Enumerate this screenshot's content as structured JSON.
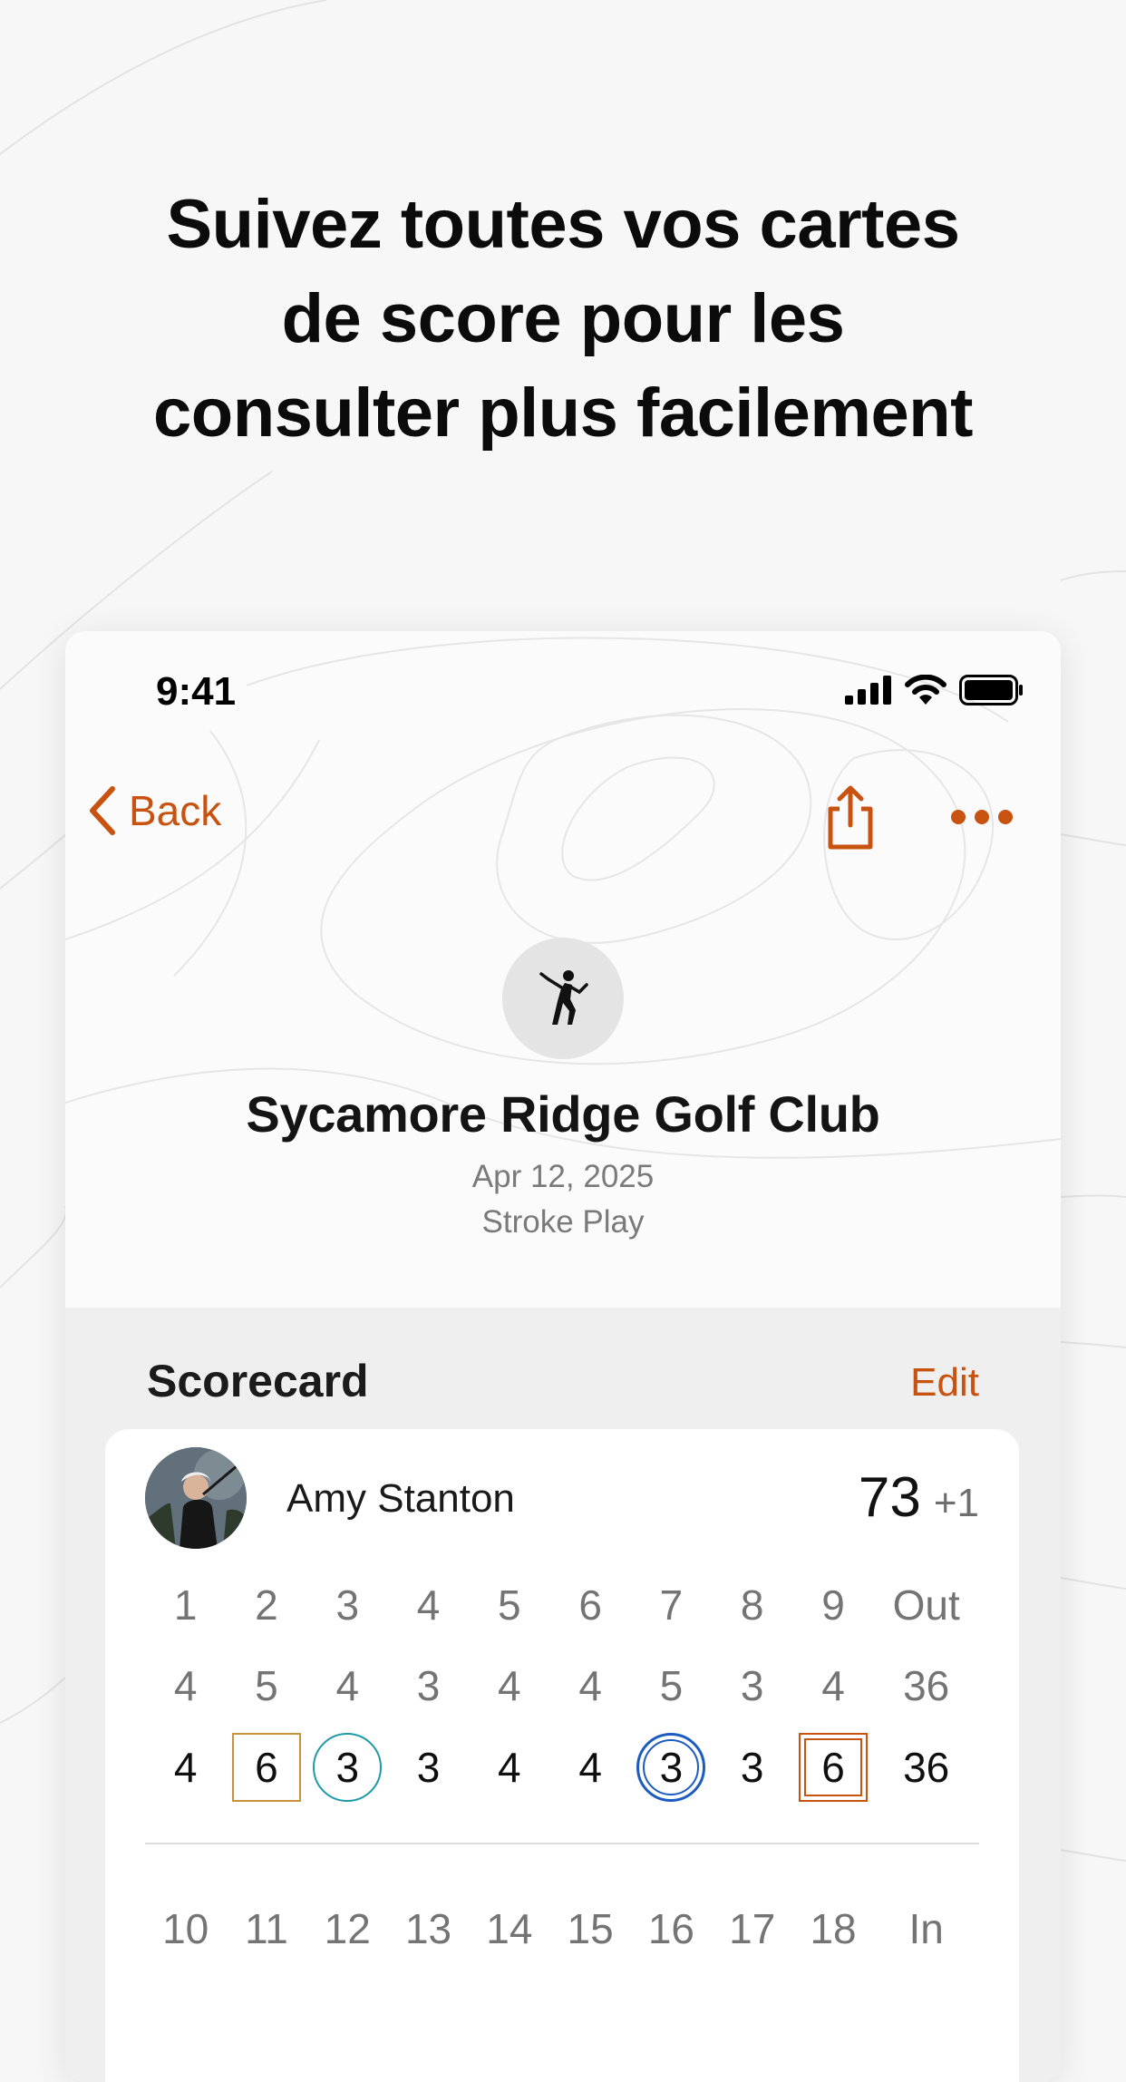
{
  "headline": {
    "line1": "Suivez toutes vos cartes",
    "line2": "de score pour les",
    "line3": "consulter plus facilement"
  },
  "status_bar": {
    "time": "9:41"
  },
  "nav": {
    "back_label": "Back"
  },
  "course": {
    "name": "Sycamore Ridge Golf Club",
    "date": "Apr 12, 2025",
    "mode": "Stroke Play"
  },
  "scorecard": {
    "title": "Scorecard",
    "edit_label": "Edit",
    "player": {
      "name": "Amy Stanton",
      "total": "73",
      "relative": "+1"
    },
    "front": {
      "holes": [
        "1",
        "2",
        "3",
        "4",
        "5",
        "6",
        "7",
        "8",
        "9",
        "Out"
      ],
      "par": [
        "4",
        "5",
        "4",
        "3",
        "4",
        "4",
        "5",
        "3",
        "4",
        "36"
      ],
      "scores": [
        "4",
        "6",
        "3",
        "3",
        "4",
        "4",
        "3",
        "3",
        "6",
        "36"
      ]
    },
    "back": {
      "holes": [
        "10",
        "11",
        "12",
        "13",
        "14",
        "15",
        "16",
        "17",
        "18",
        "In"
      ]
    }
  },
  "colors": {
    "accent": "#c8520f",
    "bogey": "#c9923b",
    "birdie": "#1d9aa5",
    "eagle": "#1c5cbf"
  }
}
